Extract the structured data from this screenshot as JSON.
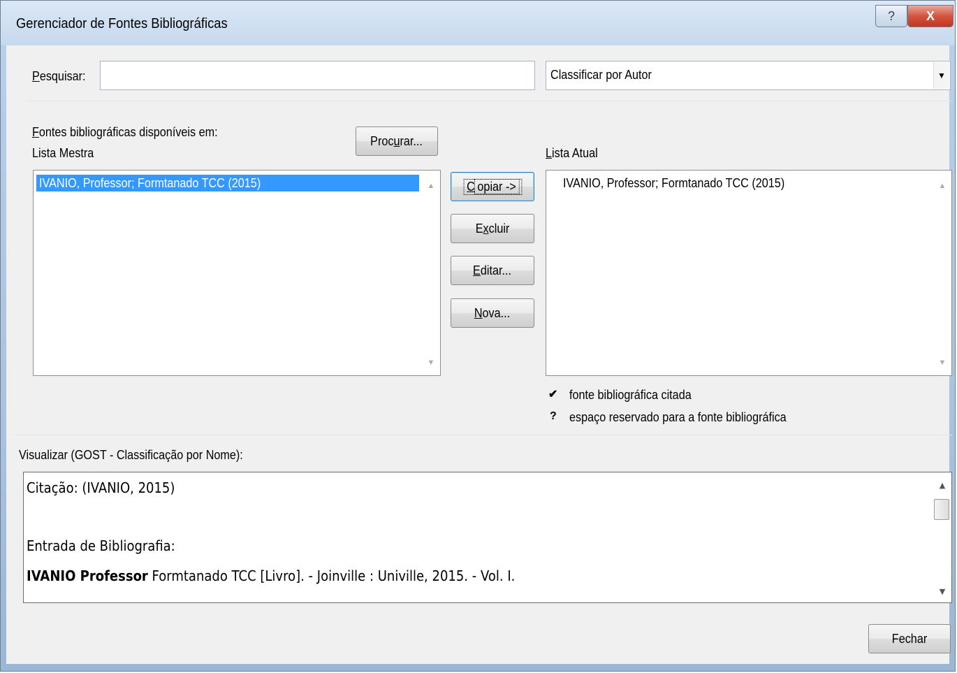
{
  "window": {
    "title": "Gerenciador de Fontes Bibliográficas",
    "help_glyph": "?",
    "close_glyph": "X"
  },
  "search": {
    "label_accel": "P",
    "label_rest": "esquisar:",
    "value": "",
    "sort_value": "Classificar por Autor"
  },
  "sources": {
    "available_accel": "F",
    "available_rest": "ontes bibliográficas disponíveis em:",
    "master_label": "Lista Mestra",
    "browse_pre": "Proc",
    "browse_accel": "u",
    "browse_post": "rar...",
    "current_accel": "L",
    "current_rest": "ista Atual",
    "master_items": [
      "IVANIO, Professor; Formtanado TCC (2015)"
    ],
    "current_items": [
      "IVANIO, Professor; Formtanado TCC (2015)"
    ]
  },
  "actions": {
    "copy_accel": "C",
    "copy_rest": "opiar ->",
    "delete_pre": "E",
    "delete_accel": "x",
    "delete_post": "cluir",
    "edit_accel": "E",
    "edit_rest": "ditar...",
    "new_accel": "N",
    "new_rest": "ova..."
  },
  "legend": {
    "cited_symbol": "✔",
    "cited_text": "fonte bibliográfica citada",
    "placeholder_symbol": "?",
    "placeholder_text": "espaço reservado para a fonte bibliográfica"
  },
  "preview": {
    "label": "Visualizar (GOST - Classificação por Nome):",
    "citation": "Citação:  (IVANIO, 2015)",
    "bibliography_label": "Entrada de Bibliografia:",
    "entry_bold": "IVANIO Professor",
    "entry_rest": " Formtanado TCC [Livro]. - Joinville : Univille, 2015. - Vol. I."
  },
  "footer": {
    "close_label": "Fechar"
  }
}
